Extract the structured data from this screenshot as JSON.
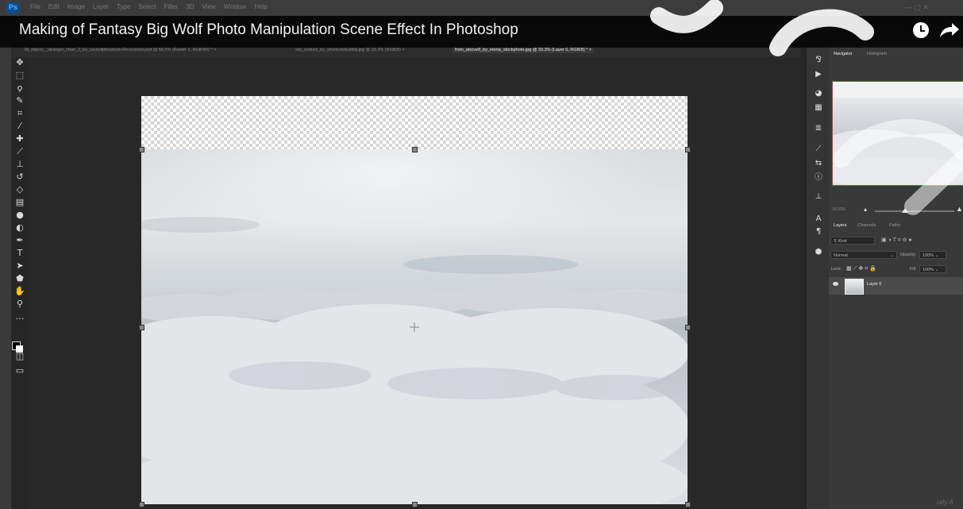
{
  "app": {
    "menu": [
      "File",
      "Edit",
      "Image",
      "Layer",
      "Type",
      "Select",
      "Filter",
      "3D",
      "View",
      "Window",
      "Help"
    ],
    "logo_text": "Ps"
  },
  "video": {
    "title": "Making of Fantasy Big Wolf Photo Manipulation Scene Effect In Photoshop",
    "icons": [
      "clock-icon",
      "share-icon"
    ]
  },
  "tabs": [
    {
      "label": "3d_object__stranger_chair_2_by_azurylipfesstock-Recovered.psd @ 56.5% (Raster 1, RGB/8#) *",
      "active": false
    },
    {
      "label": "sky_texture_by_shortcolebubbly.jpg @ 33.3% (RGB/8)",
      "active": false
    },
    {
      "label": "from_above8_by_eteria_stockphoto.jpg @ 33.3% (Layer 0, RGB/8) *",
      "active": true
    }
  ],
  "tools": [
    "move-tool",
    "marquee-tool",
    "lasso-tool",
    "quick-select-tool",
    "crop-tool",
    "eyedropper-tool",
    "healing-tool",
    "brush-tool",
    "stamp-tool",
    "history-brush-tool",
    "eraser-tool",
    "gradient-tool",
    "blur-tool",
    "dodge-tool",
    "pen-tool",
    "type-tool",
    "path-select-tool",
    "shape-tool",
    "hand-tool",
    "zoom-tool",
    "more-tools"
  ],
  "navigator": {
    "tabs": [
      "Navigator",
      "Histogram"
    ],
    "zoom": "33.33%"
  },
  "layers": {
    "tabs": [
      "Layers",
      "Channels",
      "Paths"
    ],
    "kind_label": "Kind",
    "blend_mode": "Normal",
    "opacity_label": "Opacity:",
    "opacity": "100%",
    "lock_label": "Lock:",
    "fill_label": "Fill:",
    "fill": "100%",
    "items": [
      {
        "name": "Layer 0",
        "visible": true
      }
    ]
  },
  "watermark": "rafy A",
  "colors": {
    "accent": "#4fb1ff",
    "nav_border": "#c84040",
    "panel_bg": "#393939"
  }
}
